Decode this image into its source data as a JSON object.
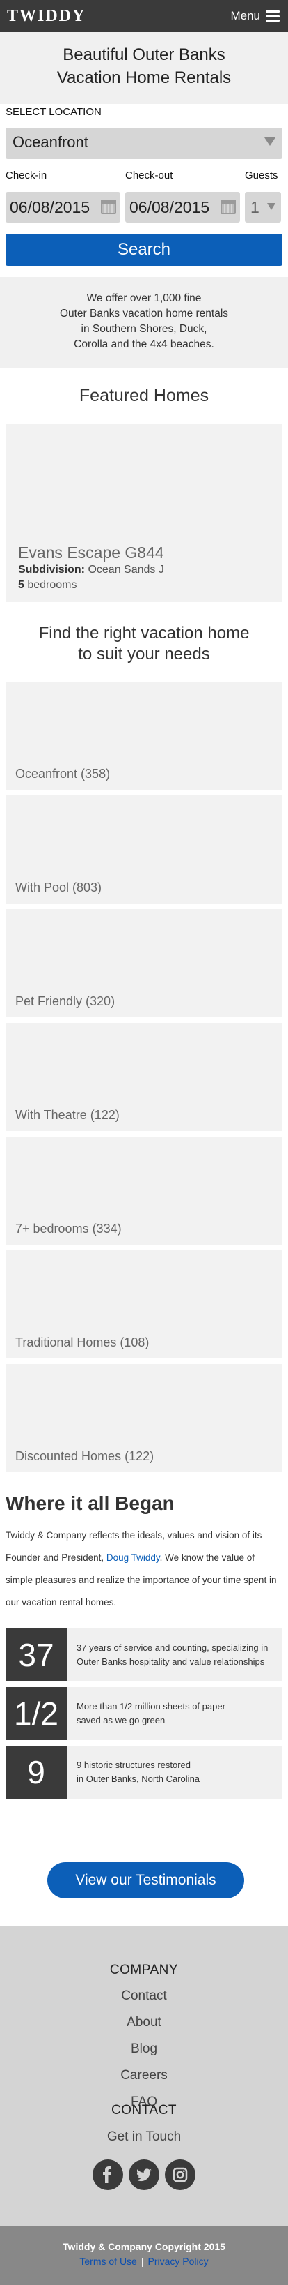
{
  "header": {
    "logo": "TWIDDY",
    "menu_label": "Menu"
  },
  "hero": {
    "title_line1": "Beautiful Outer Banks",
    "title_line2": "Vacation Home Rentals"
  },
  "search": {
    "location_label": "SELECT LOCATION",
    "location_value": "Oceanfront",
    "checkin_label": "Check-in",
    "checkin_value": "06/08/2015",
    "checkout_label": "Check-out",
    "checkout_value": "06/08/2015",
    "guests_label": "Guests",
    "guests_value": "1",
    "search_button": "Search"
  },
  "intro": {
    "line1": "We offer over 1,000 fine",
    "line2": "Outer Banks vacation home rentals",
    "line3": "in Southern Shores, Duck,",
    "line4": "Corolla and the 4x4 beaches."
  },
  "featured": {
    "title": "Featured Homes",
    "name": "Evans Escape G844",
    "subdivision_label": "Subdivision:",
    "subdivision": "Ocean Sands J",
    "bedrooms_count": "5",
    "bedrooms_label": "bedrooms"
  },
  "find": {
    "title_line1": "Find the right vacation home",
    "title_line2": "to suit your needs",
    "categories": [
      "Oceanfront (358)",
      "With Pool (803)",
      "Pet Friendly (320)",
      "With Theatre (122)",
      "7+ bedrooms (334)",
      "Traditional Homes (108)",
      "Discounted Homes (122)"
    ]
  },
  "history": {
    "title": "Where it all Began",
    "text_before": "Twiddy & Company reflects the ideals, values and vision of its Founder and President, ",
    "founder_link": "Doug Twiddy",
    "text_after": ". We know the value of simple pleasures and realize the importance of your time spent in our vacation rental homes.",
    "stats": [
      {
        "num": "37",
        "line1": "37 years of service and counting, specializing in",
        "line2": "Outer Banks hospitality and value relationships"
      },
      {
        "num": "1/2",
        "line1": "More than 1/2 million sheets of paper",
        "line2": "saved as we go green"
      },
      {
        "num": "9",
        "line1": "9 historic structures restored",
        "line2": "in Outer Banks, North Carolina"
      }
    ],
    "testimonials_button": "View our Testimonials"
  },
  "footer": {
    "company_heading": "COMPANY",
    "links": [
      "Contact",
      "About",
      "Blog",
      "Careers",
      "FAQ"
    ],
    "contact_heading": "CONTACT",
    "get_in_touch": "Get in Touch",
    "social": [
      "facebook-icon",
      "twitter-icon",
      "instagram-icon"
    ],
    "copyright": "Twiddy & Company Copyright 2015",
    "terms": "Terms of Use",
    "separator": "|",
    "privacy": "Privacy Policy"
  },
  "colors": {
    "brand_blue": "#0c5fb8",
    "dark": "#3a3a3a",
    "panel": "#f0f0f0",
    "footer": "#d4d4d4"
  }
}
